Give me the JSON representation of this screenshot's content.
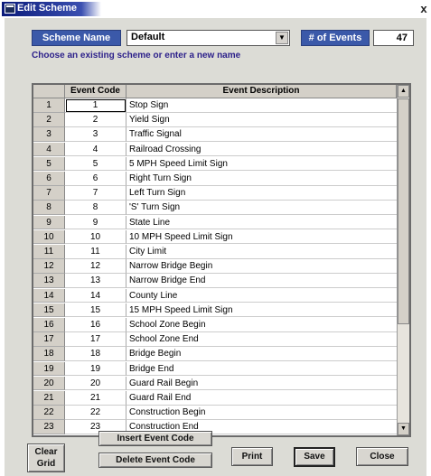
{
  "window": {
    "title": "Edit Scheme",
    "close_glyph": "x",
    "icon": "app-icon"
  },
  "scheme": {
    "name_label": "Scheme Name",
    "selected": "Default",
    "dropdown_glyph": "▼",
    "events_label": "# of Events",
    "events_count": "47",
    "hint": "Choose an existing scheme or enter a new name"
  },
  "grid": {
    "headers": {
      "row": "",
      "code": "Event Code",
      "desc": "Event Description"
    },
    "rows": [
      {
        "n": "1",
        "code": "1",
        "desc": "Stop Sign"
      },
      {
        "n": "2",
        "code": "2",
        "desc": "Yield Sign"
      },
      {
        "n": "3",
        "code": "3",
        "desc": "Traffic Signal"
      },
      {
        "n": "4",
        "code": "4",
        "desc": "Railroad Crossing"
      },
      {
        "n": "5",
        "code": "5",
        "desc": "5 MPH Speed Limit Sign"
      },
      {
        "n": "6",
        "code": "6",
        "desc": "Right Turn Sign"
      },
      {
        "n": "7",
        "code": "7",
        "desc": "Left Turn Sign"
      },
      {
        "n": "8",
        "code": "8",
        "desc": "'S' Turn Sign"
      },
      {
        "n": "9",
        "code": "9",
        "desc": "State Line"
      },
      {
        "n": "10",
        "code": "10",
        "desc": "10 MPH Speed Limit Sign"
      },
      {
        "n": "11",
        "code": "11",
        "desc": "City Limit"
      },
      {
        "n": "12",
        "code": "12",
        "desc": "Narrow Bridge Begin"
      },
      {
        "n": "13",
        "code": "13",
        "desc": "Narrow Bridge End"
      },
      {
        "n": "14",
        "code": "14",
        "desc": "County Line"
      },
      {
        "n": "15",
        "code": "15",
        "desc": "15 MPH Speed Limit Sign"
      },
      {
        "n": "16",
        "code": "16",
        "desc": "School Zone Begin"
      },
      {
        "n": "17",
        "code": "17",
        "desc": "School Zone End"
      },
      {
        "n": "18",
        "code": "18",
        "desc": "Bridge Begin"
      },
      {
        "n": "19",
        "code": "19",
        "desc": "Bridge End"
      },
      {
        "n": "20",
        "code": "20",
        "desc": "Guard Rail Begin"
      },
      {
        "n": "21",
        "code": "21",
        "desc": "Guard Rail End"
      },
      {
        "n": "22",
        "code": "22",
        "desc": "Construction Begin"
      },
      {
        "n": "23",
        "code": "23",
        "desc": "Construction End"
      }
    ],
    "scroll_up_glyph": "▲",
    "scroll_down_glyph": "▼"
  },
  "buttons": {
    "clear_grid_line1": "Clear",
    "clear_grid_line2": "Grid",
    "insert": "Insert Event Code",
    "delete": "Delete Event Code",
    "print": "Print",
    "save": "Save",
    "close": "Close"
  },
  "colors": {
    "label_bg": "#3b59a9",
    "hint_text": "#2b1f8a",
    "dialog_bg": "#dcdcd6"
  }
}
